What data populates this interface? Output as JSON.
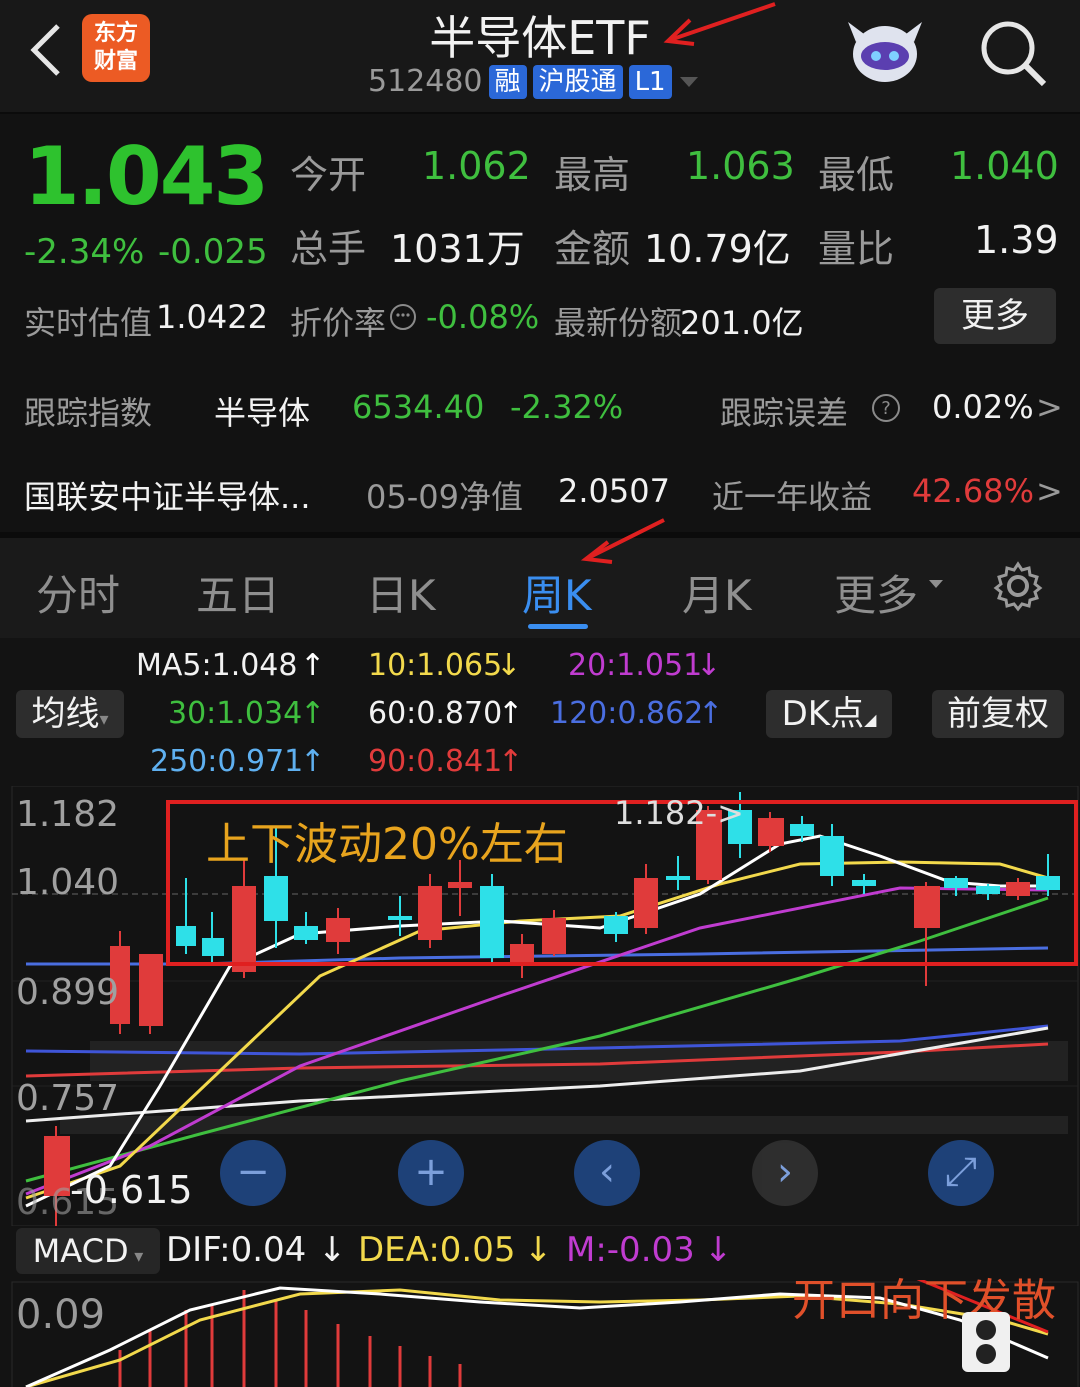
{
  "header": {
    "logo": [
      "东方",
      "财富"
    ],
    "title": "半导体ETF",
    "code": "512480",
    "tags": [
      "融",
      "沪股通",
      "L1"
    ]
  },
  "quote": {
    "price": "1.043",
    "change_pct": "-2.34%",
    "change": "-0.025",
    "open_label": "今开",
    "open": "1.062",
    "high_label": "最高",
    "high": "1.063",
    "low_label": "最低",
    "low": "1.040",
    "volume_label": "总手",
    "volume": "1031万",
    "amount_label": "金额",
    "amount": "10.79亿",
    "ratio_label": "量比",
    "ratio": "1.39",
    "iopv_label": "实时估值",
    "iopv": "1.0422",
    "discount_label": "折价率",
    "discount": "-0.08%",
    "shares_label": "最新份额",
    "shares": "201.0亿",
    "more": "更多"
  },
  "tracking": {
    "index_label": "跟踪指数",
    "index_name": "半导体",
    "index_value": "6534.40",
    "index_change": "-2.32%",
    "error_label": "跟踪误差",
    "error": "0.02%",
    "fund_name": "国联安中证半导体...",
    "nav_label": "05-09净值",
    "nav": "2.0507",
    "year_label": "近一年收益",
    "year_return": "42.68%"
  },
  "tabs": [
    "分时",
    "五日",
    "日K",
    "周K",
    "月K",
    "更多"
  ],
  "active_tab": "周K",
  "ma": {
    "ma5": "MA5:1.048",
    "ma10": "10:1.065",
    "ma20": "20:1.051",
    "ma30": "30:1.034",
    "ma60": "60:0.870",
    "ma120": "120:0.862",
    "ma250": "250:0.971",
    "ma90": "90:0.841",
    "avg_btn": "均线",
    "dk_btn": "DK点",
    "fq_btn": "前复权"
  },
  "axis": {
    "y1": "1.182",
    "y2": "1.040",
    "y3": "0.899",
    "y4": "0.757",
    "y5": "0.615",
    "low_mark": "-0.615",
    "high_mark": "1.182->"
  },
  "annotations": {
    "range": "上下波动20%左右",
    "macd_note": "开口向下发散"
  },
  "macd": {
    "label": "MACD",
    "dif": "DIF:0.04",
    "dea": "DEA:0.05",
    "m": "M:-0.03",
    "axis": "0.09"
  },
  "colors": {
    "up": "#e03b3b",
    "down": "#2ee0e8",
    "green": "#3fbf3f",
    "accent": "#3a8ef0"
  }
}
